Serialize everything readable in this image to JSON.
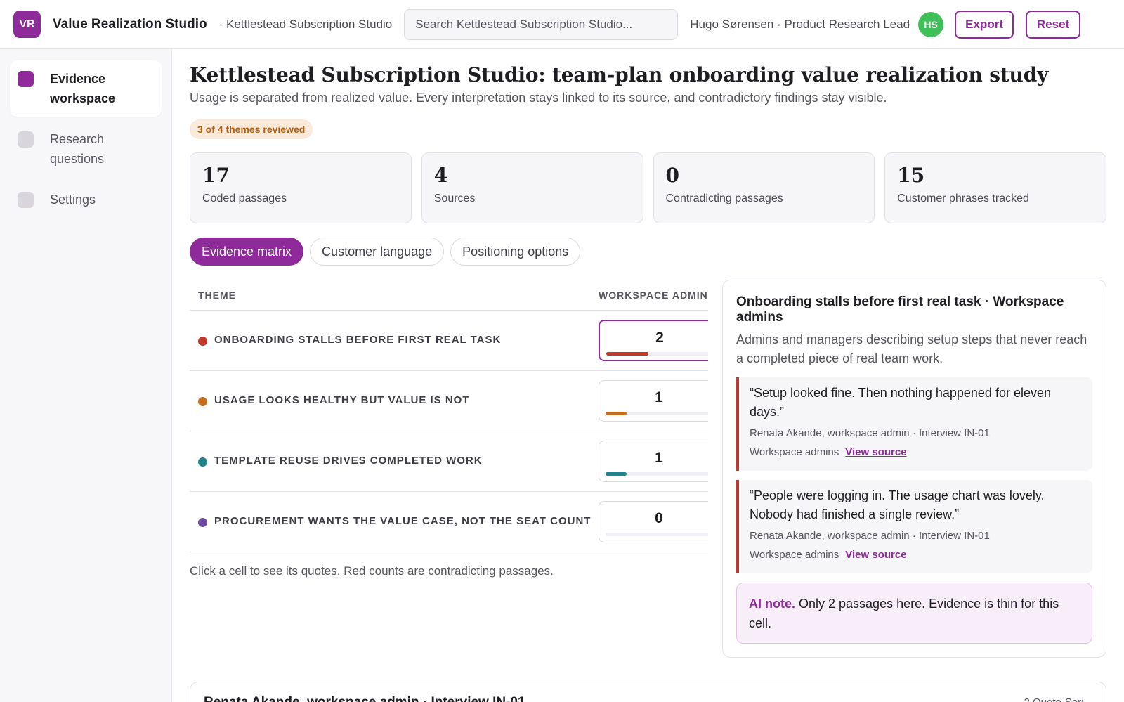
{
  "header": {
    "logo_text": "VR",
    "app_name": "Value Realization Studio",
    "workspace": "· Kettlestead Subscription Studio",
    "search_placeholder": "Search Kettlestead Subscription Studio...",
    "user": "Hugo Sørensen · Product Research Lead",
    "avatar_initials": "HS",
    "export_label": "Export",
    "reset_label": "Reset"
  },
  "sidebar": {
    "items": [
      {
        "label": "Evidence workspace",
        "active": true
      },
      {
        "label": "Research questions",
        "active": false
      },
      {
        "label": "Settings",
        "active": false
      }
    ]
  },
  "page": {
    "title": "Kettlestead Subscription Studio: team-plan onboarding value realization study",
    "subtitle": "Usage is separated from realized value. Every interpretation stays linked to its source, and contradictory findings stay visible.",
    "review_badge": "3 of 4 themes reviewed"
  },
  "stats": [
    {
      "value": "17",
      "label": "Coded passages"
    },
    {
      "value": "4",
      "label": "Sources"
    },
    {
      "value": "0",
      "label": "Contradicting passages"
    },
    {
      "value": "15",
      "label": "Customer phrases tracked"
    }
  ],
  "tabs": [
    {
      "label": "Evidence matrix",
      "active": true
    },
    {
      "label": "Customer language",
      "active": false
    },
    {
      "label": "Positioning options",
      "active": false
    }
  ],
  "matrix": {
    "columns": {
      "theme": "THEME",
      "segment": "WORKSPACE ADMIN"
    },
    "rows": [
      {
        "theme": "ONBOARDING STALLS BEFORE FIRST REAL TASK",
        "dot_color": "#c0392b",
        "count": "2",
        "bar_fraction": 0.375,
        "bar_color": "#c0392b",
        "selected": true
      },
      {
        "theme": "USAGE LOOKS HEALTHY BUT VALUE IS NOT",
        "dot_color": "#c46d1d",
        "count": "1",
        "bar_fraction": 0.19,
        "bar_color": "#c46d1d",
        "selected": false
      },
      {
        "theme": "TEMPLATE REUSE DRIVES COMPLETED WORK",
        "dot_color": "#23838a",
        "count": "1",
        "bar_fraction": 0.19,
        "bar_color": "#23838a",
        "selected": false
      },
      {
        "theme": "PROCUREMENT WANTS THE VALUE CASE, NOT THE SEAT COUNT",
        "dot_color": "#6d4ba3",
        "count": "0",
        "bar_fraction": 0,
        "bar_color": "#6d4ba3",
        "selected": false
      }
    ],
    "note": "Click a cell to see its quotes. Red counts are contradicting passages."
  },
  "detail": {
    "title": "Onboarding stalls before first real task · Workspace admins",
    "description": "Admins and managers describing setup steps that never reach a completed piece of real team work.",
    "quotes": [
      {
        "text": "“Setup looked fine. Then nothing happened for eleven days.”",
        "attribution": "Renata Akande, workspace admin · Interview IN-01",
        "segment": "Workspace admins",
        "link": "View source"
      },
      {
        "text": "“People were logging in. The usage chart was lovely. Nobody had finished a single review.”",
        "attribution": "Renata Akande, workspace admin · Interview IN-01",
        "segment": "Workspace admins",
        "link": "View source"
      }
    ],
    "ai_note_label": "AI note.",
    "ai_note_text": " Only 2 passages here. Evidence is thin for this cell."
  },
  "source_card": {
    "title": "Renata Akande, workspace admin · Interview IN-01",
    "meta": "2 Quote·Seri..."
  }
}
